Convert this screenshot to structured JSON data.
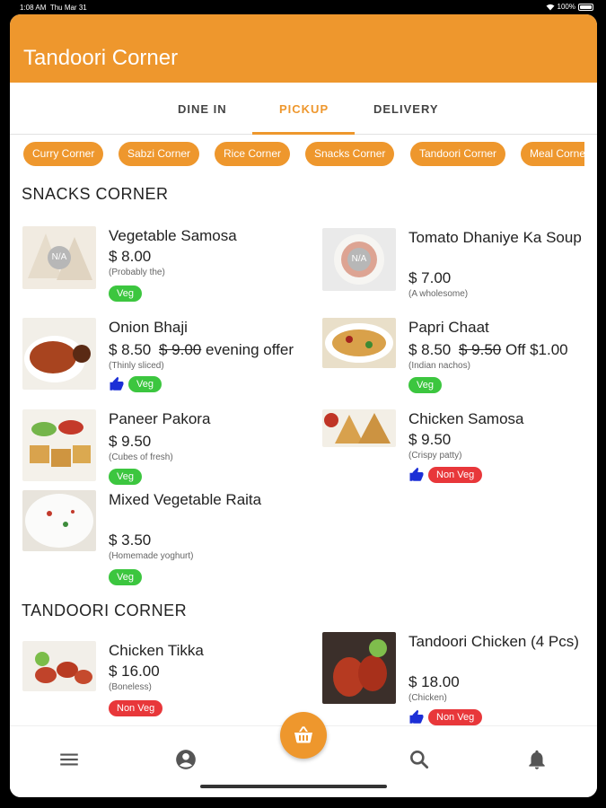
{
  "status": {
    "time": "1:08 AM",
    "date": "Thu Mar 31",
    "battery": "100%"
  },
  "app": {
    "title": "Tandoori Corner"
  },
  "tabs": [
    {
      "label": "DINE IN"
    },
    {
      "label": "PICKUP"
    },
    {
      "label": "DELIVERY"
    }
  ],
  "active_tab": "PICKUP",
  "categories": [
    {
      "label": "Curry Corner"
    },
    {
      "label": "Sabzi Corner"
    },
    {
      "label": "Rice Corner"
    },
    {
      "label": "Snacks Corner"
    },
    {
      "label": "Tandoori Corner"
    },
    {
      "label": "Meal Corner"
    }
  ],
  "sections": [
    {
      "title": "SNACKS CORNER",
      "items": [
        {
          "name": "Vegetable Samosa",
          "price": "$ 8.00",
          "old_price": "",
          "offer": "",
          "desc": "(Probably the)",
          "liked": false,
          "badge": "Veg",
          "placeholder": "N/A"
        },
        {
          "name": "Tomato Dhaniye Ka Soup",
          "price": "$ 7.00",
          "old_price": "",
          "offer": "",
          "desc": "(A wholesome)",
          "liked": false,
          "badge": "",
          "placeholder": "N/A"
        },
        {
          "name": "Onion Bhaji",
          "price": "$ 8.50",
          "old_price": "$ 9.00",
          "offer": "evening offer",
          "desc": "(Thinly sliced)",
          "liked": true,
          "badge": "Veg",
          "placeholder": ""
        },
        {
          "name": "Papri Chaat",
          "price": "$ 8.50",
          "old_price": "$ 9.50",
          "offer": "Off $1.00",
          "desc": "(Indian nachos)",
          "liked": false,
          "badge": "Veg",
          "placeholder": ""
        },
        {
          "name": "Paneer Pakora",
          "price": "$ 9.50",
          "old_price": "",
          "offer": "",
          "desc": "(Cubes of fresh)",
          "liked": false,
          "badge": "Veg",
          "placeholder": ""
        },
        {
          "name": "Chicken Samosa",
          "price": "$ 9.50",
          "old_price": "",
          "offer": "",
          "desc": "(Crispy patty)",
          "liked": true,
          "badge": "Non Veg",
          "placeholder": ""
        },
        {
          "name": "Mixed Vegetable Raita",
          "price": "$ 3.50",
          "old_price": "",
          "offer": "",
          "desc": "(Homemade yoghurt)",
          "liked": false,
          "badge": "Veg",
          "placeholder": ""
        }
      ]
    },
    {
      "title": "TANDOORI CORNER",
      "items": [
        {
          "name": "Chicken Tikka",
          "price": "$ 16.00",
          "old_price": "",
          "offer": "",
          "desc": "(Boneless)",
          "liked": false,
          "badge": "Non Veg",
          "placeholder": ""
        },
        {
          "name": "Tandoori Chicken (4 Pcs)",
          "price": "$ 18.00",
          "old_price": "",
          "offer": "",
          "desc": "(Chicken)",
          "liked": true,
          "badge": "Non Veg",
          "placeholder": ""
        }
      ]
    }
  ],
  "bottom_nav": [
    {
      "icon": "menu-icon"
    },
    {
      "icon": "account-icon"
    },
    {
      "icon": "cart-icon"
    },
    {
      "icon": "search-icon"
    },
    {
      "icon": "notification-icon"
    }
  ],
  "colors": {
    "accent": "#EE972D",
    "veg": "#3CC63F",
    "nonveg": "#E8373A",
    "like": "#1C2FD6"
  }
}
